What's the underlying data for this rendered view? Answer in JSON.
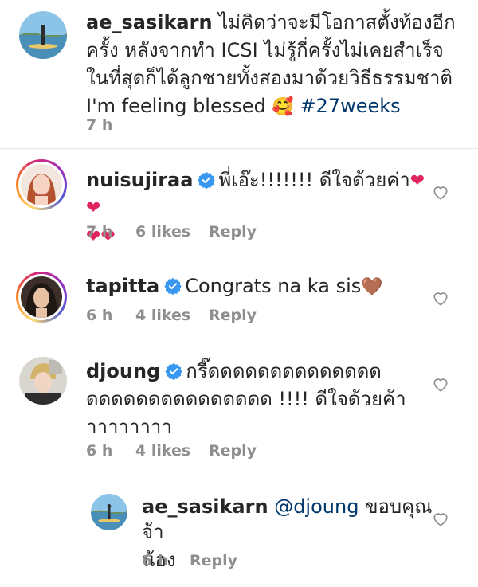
{
  "caption": {
    "username": "ae_sasikarn",
    "line1": "ไม่คิดว่าจะมีโอกาสตั้งท้องอีก",
    "line2": "ครั้ง หลังจากทำ ICSI ไม่รู้กี่ครั้งไม่เคยสำเร็จ",
    "line3": "ในที่สุดก็ได้ลูกชายทั้งสองมาด้วยวิธีธรรมชาติ",
    "line4_text": "I'm feeling blessed",
    "line4_emoji": "🥰",
    "hashtag": "#27weeks",
    "time": "7 h"
  },
  "comments": [
    {
      "username": "nuisujiraa",
      "text1": "พี่เอ๊ะ!!!!!!! ดีใจด้วยค่า",
      "hearts1": "❤❤",
      "hearts2": "❤❤",
      "time": "7 h",
      "likes": "6 likes",
      "reply": "Reply"
    },
    {
      "username": "tapitta",
      "text1": "Congrats na ka sis",
      "emoji": "🤎",
      "time": "6 h",
      "likes": "4 likes",
      "reply": "Reply"
    },
    {
      "username": "djoung",
      "text1": "กรี๊ดดดดดดดดดดดดดด",
      "text2": "ดดดดดดดดดดดดดดด !!!! ดีใจด้วยค้า",
      "text3": "าาาาาาาา",
      "time": "6 h",
      "likes": "4 likes",
      "reply": "Reply"
    }
  ],
  "reply_comment": {
    "username": "ae_sasikarn",
    "mention": "@djoung",
    "text1": "ขอบคุณจ้า",
    "text2": "น้อง",
    "time": "6 h",
    "reply": "Reply"
  },
  "colors": {
    "text": "#262626",
    "meta": "#8e8e8e",
    "link": "#00376b",
    "verified": "#3897f0",
    "heart_emoji": "#e0245e"
  }
}
